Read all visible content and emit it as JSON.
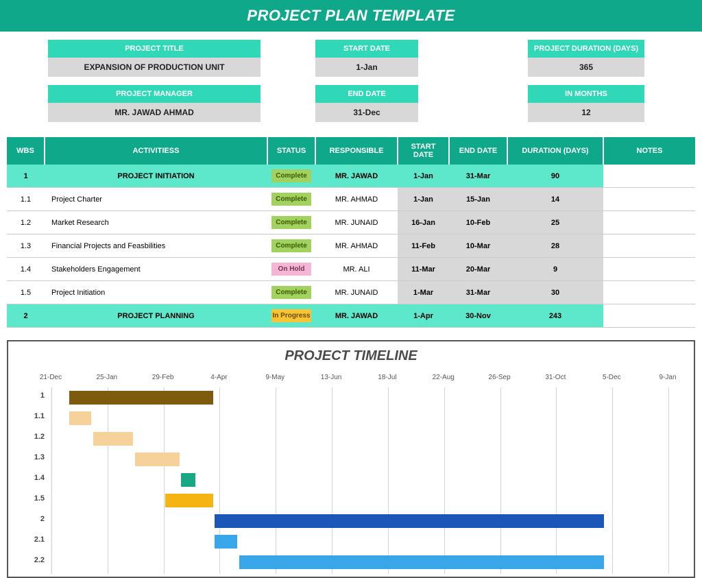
{
  "title": "PROJECT PLAN TEMPLATE",
  "meta": {
    "project_title_label": "PROJECT TITLE",
    "project_title": "EXPANSION OF PRODUCTION UNIT",
    "start_date_label": "START DATE",
    "start_date": "1-Jan",
    "duration_days_label": "PROJECT DURATION (DAYS)",
    "duration_days": "365",
    "project_manager_label": "PROJECT MANAGER",
    "project_manager": "MR. JAWAD AHMAD",
    "end_date_label": "END DATE",
    "end_date": "31-Dec",
    "in_months_label": "IN MONTHS",
    "in_months": "12"
  },
  "columns": {
    "wbs": "WBS",
    "activities": "ACTIVITIESS",
    "status": "STATUS",
    "responsible": "RESPONSIBLE",
    "start_date": "START DATE",
    "end_date": "END DATE",
    "duration": "DURATION (DAYS)",
    "notes": "NOTES"
  },
  "status_text": {
    "complete": "Complete",
    "hold": "On Hold",
    "progress": "In Progress"
  },
  "rows": [
    {
      "wbs": "1",
      "activity": "PROJECT INITIATION",
      "status": "complete",
      "responsible": "MR. JAWAD",
      "sd": "1-Jan",
      "ed": "31-Mar",
      "dur": "90",
      "section": true
    },
    {
      "wbs": "1.1",
      "activity": "Project Charter",
      "status": "complete",
      "responsible": "MR. AHMAD",
      "sd": "1-Jan",
      "ed": "15-Jan",
      "dur": "14"
    },
    {
      "wbs": "1.2",
      "activity": "Market Research",
      "status": "complete",
      "responsible": "MR. JUNAID",
      "sd": "16-Jan",
      "ed": "10-Feb",
      "dur": "25"
    },
    {
      "wbs": "1.3",
      "activity": "Financial Projects and Feasbilities",
      "status": "complete",
      "responsible": "MR. AHMAD",
      "sd": "11-Feb",
      "ed": "10-Mar",
      "dur": "28"
    },
    {
      "wbs": "1.4",
      "activity": "Stakeholders Engagement",
      "status": "hold",
      "responsible": "MR. ALI",
      "sd": "11-Mar",
      "ed": "20-Mar",
      "dur": "9"
    },
    {
      "wbs": "1.5",
      "activity": "Project Initiation",
      "status": "complete",
      "responsible": "MR. JUNAID",
      "sd": "1-Mar",
      "ed": "31-Mar",
      "dur": "30"
    },
    {
      "wbs": "2",
      "activity": "PROJECT PLANNING",
      "status": "progress",
      "responsible": "MR. JAWAD",
      "sd": "1-Apr",
      "ed": "30-Nov",
      "dur": "243",
      "section": true
    }
  ],
  "timeline": {
    "title": "PROJECT TIMELINE",
    "ticks": [
      "21-Dec",
      "25-Jan",
      "29-Feb",
      "4-Apr",
      "9-May",
      "13-Jun",
      "18-Jul",
      "22-Aug",
      "26-Sep",
      "31-Oct",
      "5-Dec",
      "9-Jan"
    ],
    "row_labels": [
      "1",
      "1.1",
      "1.2",
      "1.3",
      "1.4",
      "1.5",
      "2",
      "2.1",
      "2.2"
    ]
  },
  "chart_data": {
    "type": "bar",
    "title": "PROJECT TIMELINE",
    "xlabel": "",
    "ylabel": "",
    "x_ticks": [
      "21-Dec",
      "25-Jan",
      "29-Feb",
      "4-Apr",
      "9-May",
      "13-Jun",
      "18-Jul",
      "22-Aug",
      "26-Sep",
      "31-Oct",
      "5-Dec",
      "9-Jan"
    ],
    "x_range_days": [
      0,
      385
    ],
    "series": [
      {
        "name": "1",
        "start": "1-Jan",
        "end": "31-Mar",
        "offset": 11,
        "length": 90,
        "color": "#7d5a0e"
      },
      {
        "name": "1.1",
        "start": "1-Jan",
        "end": "15-Jan",
        "offset": 11,
        "length": 14,
        "color": "#f7d19a"
      },
      {
        "name": "1.2",
        "start": "16-Jan",
        "end": "10-Feb",
        "offset": 26,
        "length": 25,
        "color": "#f7d19a"
      },
      {
        "name": "1.3",
        "start": "11-Feb",
        "end": "10-Mar",
        "offset": 52,
        "length": 28,
        "color": "#f7d19a"
      },
      {
        "name": "1.4",
        "start": "11-Mar",
        "end": "20-Mar",
        "offset": 81,
        "length": 9,
        "color": "#18a884"
      },
      {
        "name": "1.5",
        "start": "1-Mar",
        "end": "31-Mar",
        "offset": 71,
        "length": 30,
        "color": "#f6b412"
      },
      {
        "name": "2",
        "start": "1-Apr",
        "end": "30-Nov",
        "offset": 102,
        "length": 243,
        "color": "#1a57b8"
      },
      {
        "name": "2.1",
        "start": "1-Apr",
        "end": "15-Apr",
        "offset": 102,
        "length": 14,
        "color": "#3aa6ea"
      },
      {
        "name": "2.2",
        "start": "16-Apr",
        "end": "30-Nov",
        "offset": 117,
        "length": 228,
        "color": "#3aa6ea"
      }
    ]
  }
}
